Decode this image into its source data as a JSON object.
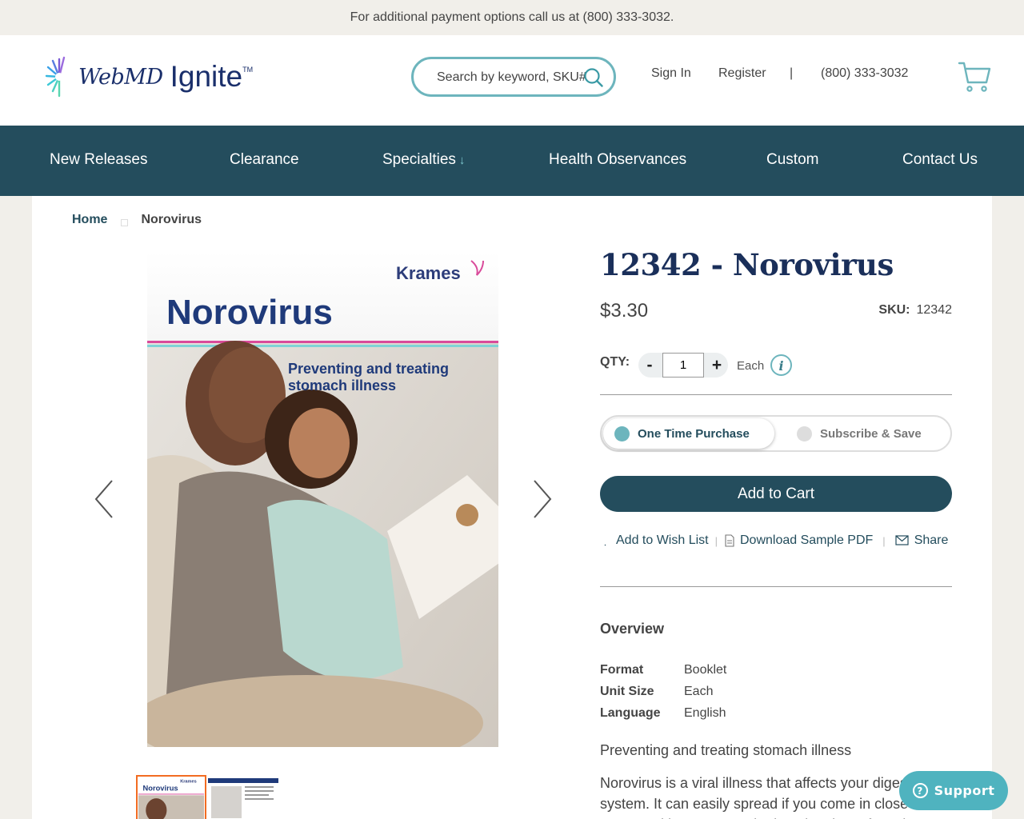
{
  "topbar": {
    "text": "For additional payment options call us at (800) 333-3032."
  },
  "header": {
    "logo_webmd": "WebMD",
    "logo_ignite": "Ignite",
    "logo_tm": "TM",
    "search_placeholder": "Search by keyword, SKU#",
    "sign_in": "Sign In",
    "register": "Register",
    "separator": "|",
    "phone": "(800) 333-3032"
  },
  "nav": {
    "items": [
      "New Releases",
      "Clearance",
      "Specialties",
      "Health Observances",
      "Custom",
      "Contact Us"
    ]
  },
  "breadcrumb": {
    "home": "Home",
    "current": "Norovirus"
  },
  "product_image": {
    "brand": "Krames",
    "title": "Norovirus",
    "subtitle_line1": "Preventing and treating",
    "subtitle_line2": "stomach illness"
  },
  "thumbnail": {
    "brand": "Krames",
    "title": "Norovirus"
  },
  "product": {
    "title": "12342 - Norovirus",
    "price": "$3.30",
    "sku_label": "SKU:",
    "sku_value": "12342",
    "qty_label": "QTY:",
    "qty_minus": "-",
    "qty_plus": "+",
    "qty_value": "1",
    "unit": "Each",
    "purchase_options": [
      "One Time Purchase",
      "Subscribe & Save"
    ],
    "add_to_cart": "Add to Cart",
    "actions": {
      "wishlist": "Add to Wish List",
      "download": "Download Sample PDF",
      "share": "Share",
      "sep": "|"
    }
  },
  "overview": {
    "title": "Overview",
    "specs": [
      {
        "label": "Format",
        "value": "Booklet"
      },
      {
        "label": "Unit Size",
        "value": "Each"
      },
      {
        "label": "Language",
        "value": "English"
      }
    ],
    "subtitle": "Preventing and treating stomach illness",
    "description": "Norovirus is a viral illness that affects your digestive system. It can easily spread if you come in close contact with someone who has the virus. If you have norovirus, you may"
  },
  "support": {
    "label": "Support"
  },
  "colors": {
    "nav_bg": "#244d5d",
    "accent_teal": "#6db5bd",
    "title_navy": "#1a2f5a",
    "support_bg": "#4fb3bf",
    "thumb_border": "#f26c22"
  }
}
